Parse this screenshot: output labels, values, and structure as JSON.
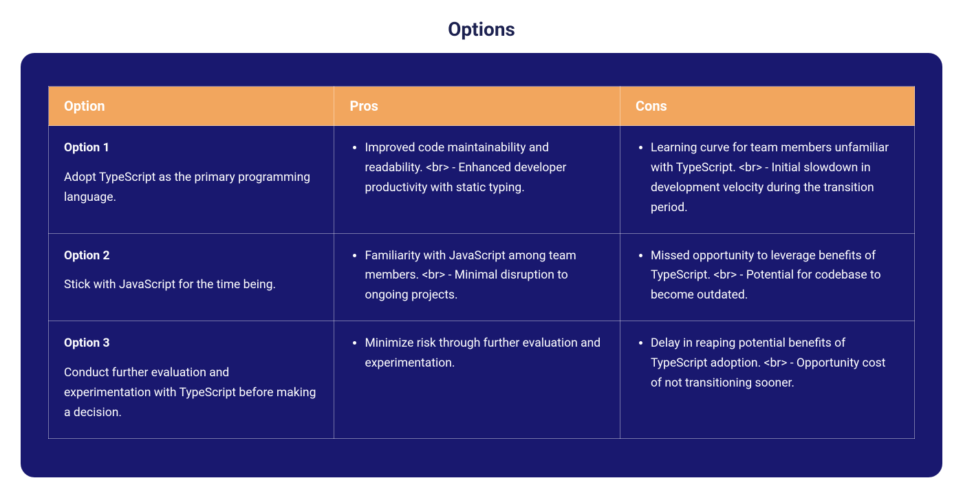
{
  "heading": "Options",
  "table": {
    "headers": [
      "Option",
      "Pros",
      "Cons"
    ],
    "rows": [
      {
        "title": "Option 1",
        "description": "Adopt TypeScript as the primary programming language.",
        "pros": "Improved code maintainability and readability. <br> - Enhanced developer productivity with static typing.",
        "cons": "Learning curve for team members unfamiliar with TypeScript. <br> - Initial slowdown in development velocity during the transition period."
      },
      {
        "title": "Option 2",
        "description": "Stick with JavaScript for the time being.",
        "pros": "Familiarity with JavaScript among team members. <br> - Minimal disruption to ongoing projects.",
        "cons": "Missed opportunity to leverage benefits of TypeScript. <br> - Potential for codebase to become outdated."
      },
      {
        "title": "Option 3",
        "description": "Conduct further evaluation and experimentation with TypeScript before making a decision.",
        "pros": "Minimize risk through further evaluation and experimentation.",
        "cons": "Delay in reaping potential benefits of TypeScript adoption. <br> - Opportunity cost of not transitioning sooner."
      }
    ]
  }
}
